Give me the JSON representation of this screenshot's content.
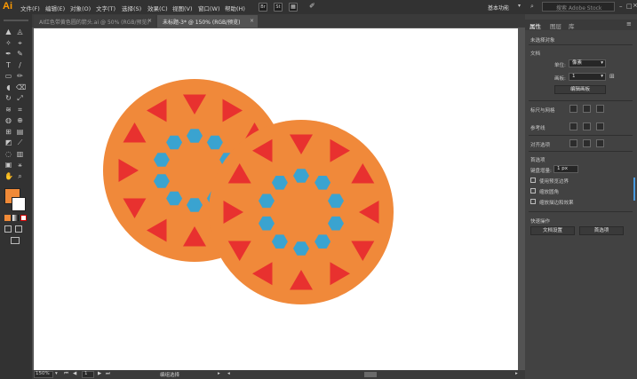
{
  "menubar": {
    "logo": "Ai",
    "items": [
      "文件(F)",
      "编辑(E)",
      "对象(O)",
      "文字(T)",
      "选择(S)",
      "效果(C)",
      "视图(V)",
      "窗口(W)",
      "帮助(H)"
    ],
    "app_icons": [
      "Br",
      "St"
    ],
    "workspace": "基本功能",
    "stock_search_placeholder": "搜索 Adobe Stock"
  },
  "tabs": [
    {
      "label": "AI红色带黄色圆的箭头.ai @ 50% (RGB/预览)",
      "active": false
    },
    {
      "label": "未标题-3* @ 150% (RGB/预览)",
      "active": true
    }
  ],
  "statusbar": {
    "zoom": "150%",
    "page": "1",
    "tool_status": "编组选择"
  },
  "panel": {
    "tabs": [
      "属性",
      "图层",
      "库"
    ],
    "no_selection": "未选择对象",
    "document_section": "文档",
    "units_label": "单位:",
    "units_value": "像素",
    "artboard_label": "画板:",
    "artboard_value": "1",
    "edit_artboard_button": "编辑画板",
    "rulers_grid": "标尺与网格",
    "guides": "参考线",
    "align_selection": "对齐选项",
    "preferences": "首选项",
    "keyboard_increment_label": "键盘增量:",
    "keyboard_increment_value": "1 px",
    "checkboxes": [
      "使用预览边界",
      "缩放圆角",
      "缩放描边和效果"
    ],
    "quick_actions": "快速操作",
    "document_setup_button": "文档设置",
    "preferences_button": "首选项"
  },
  "colors": {
    "fill": "#f08a38",
    "triangle": "#e8312f",
    "hexagon": "#3aa3d0",
    "circle": "#f0893a",
    "accent": "#4a9be0"
  }
}
